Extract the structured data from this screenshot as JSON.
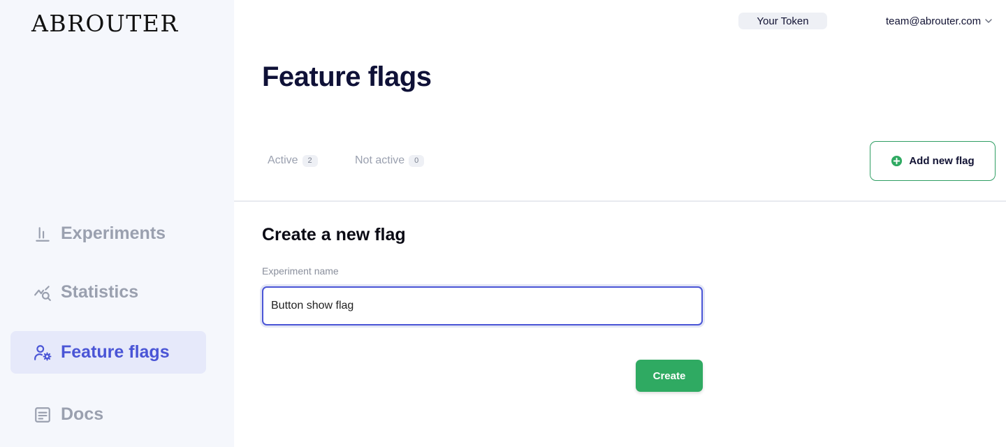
{
  "app": {
    "logo_text": "ABROUTER"
  },
  "sidebar": {
    "items": [
      {
        "label": "Experiments",
        "icon": "bar-chart-icon",
        "active": false
      },
      {
        "label": "Statistics",
        "icon": "chart-search-icon",
        "active": false
      },
      {
        "label": "Feature flags",
        "icon": "user-gear-icon",
        "active": true
      },
      {
        "label": "Docs",
        "icon": "document-icon",
        "active": false
      }
    ]
  },
  "header": {
    "token_label": "Your Token",
    "user_email": "team@abrouter.com"
  },
  "main": {
    "title": "Feature flags",
    "tabs": [
      {
        "label": "Active",
        "count": "2"
      },
      {
        "label": "Not active",
        "count": "0"
      }
    ],
    "add_button_label": "Add new flag",
    "form": {
      "title": "Create a new flag",
      "field_label": "Experiment name",
      "field_value": "Button show flag",
      "submit_label": "Create"
    }
  },
  "colors": {
    "accent": "#4a55d6",
    "success": "#2faa62",
    "sidebar_bg": "#f5f7fc",
    "active_nav_bg": "#e6e9fa"
  }
}
